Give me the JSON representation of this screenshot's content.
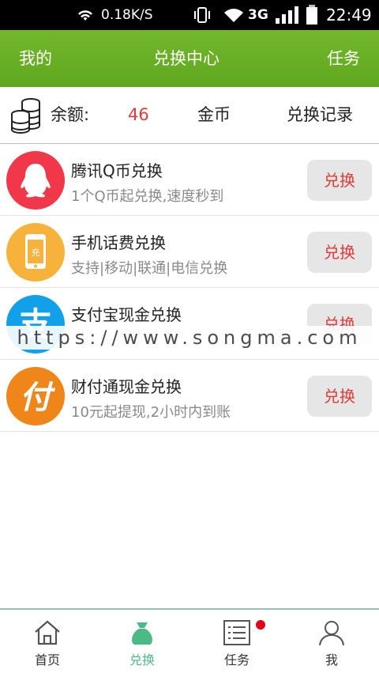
{
  "status_bar": {
    "net_speed": "0.18K/S",
    "network": "3G",
    "time": "22:49"
  },
  "header": {
    "left": "我的",
    "title": "兑换中心",
    "right": "任务"
  },
  "balance": {
    "label": "余额:",
    "value": "46",
    "unit": "金币",
    "records_link": "兑换记录"
  },
  "items": [
    {
      "title": "腾讯Q币兑换",
      "subtitle": "1个Q币起兑换,速度秒到",
      "button": "兑换"
    },
    {
      "title": "手机话费兑换",
      "subtitle": "支持|移动|联通|电信兑换",
      "button": "兑换",
      "icon_text": "充"
    },
    {
      "title": "支付宝现金兑换",
      "subtitle": "",
      "button": "兑换",
      "icon_text": "支"
    },
    {
      "title": "财付通现金兑换",
      "subtitle": "10元起提现,2小时内到账",
      "button": "兑换",
      "icon_text": "付"
    }
  ],
  "watermark": "https://www.songma.com",
  "bottom_nav": [
    {
      "label": "首页"
    },
    {
      "label": "兑换"
    },
    {
      "label": "任务"
    },
    {
      "label": "我"
    }
  ],
  "colors": {
    "header_green": "#6cb225",
    "accent_red": "#e03b3b",
    "active_nav": "#4cba86",
    "qq_red": "#f0384a",
    "phone_orange": "#f7b23b",
    "alipay_blue": "#12a0e8",
    "tenpay_orange": "#f08519"
  }
}
